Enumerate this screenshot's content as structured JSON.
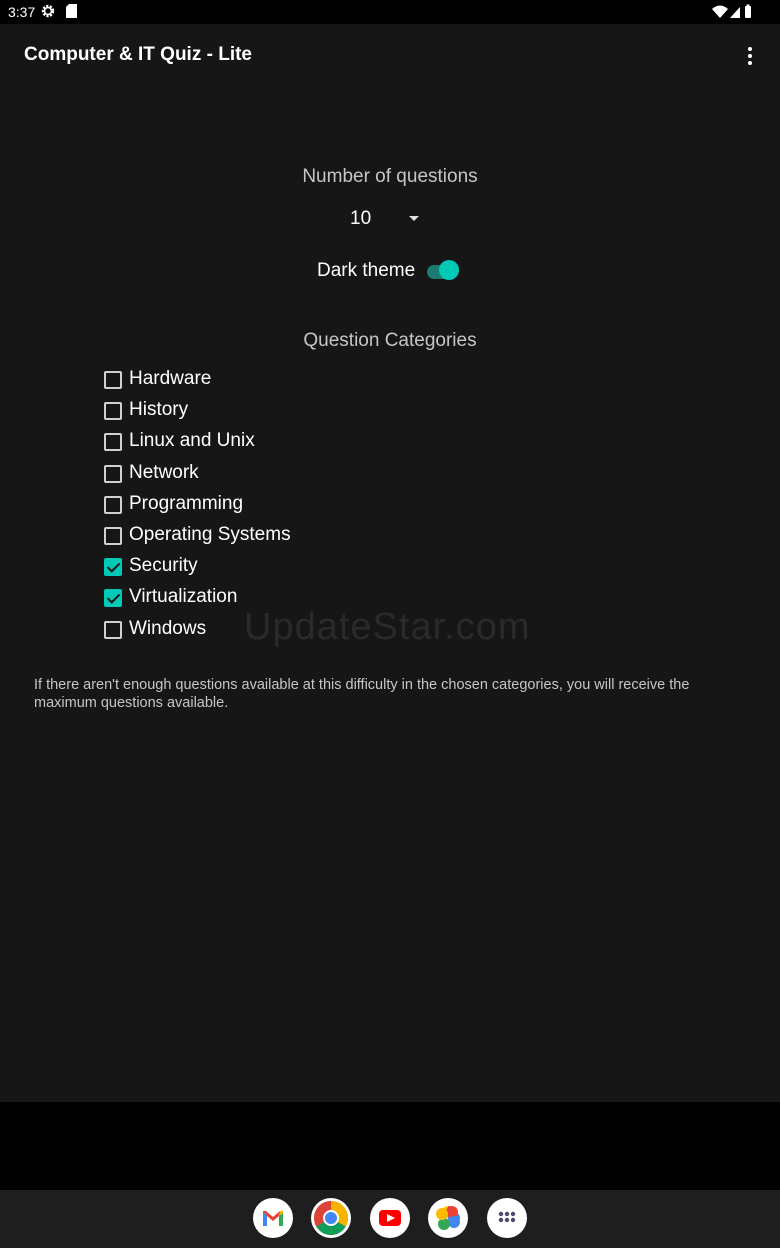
{
  "status_bar": {
    "time": "3:37"
  },
  "app_bar": {
    "title": "Computer & IT Quiz - Lite"
  },
  "settings": {
    "num_questions_label": "Number of questions",
    "num_questions_value": "10",
    "dark_theme_label": "Dark theme",
    "dark_theme_on": true,
    "categories_title": "Question Categories",
    "categories": [
      {
        "label": "Hardware",
        "checked": false
      },
      {
        "label": "History",
        "checked": false
      },
      {
        "label": "Linux and Unix",
        "checked": false
      },
      {
        "label": "Network",
        "checked": false
      },
      {
        "label": "Programming",
        "checked": false
      },
      {
        "label": "Operating Systems",
        "checked": false
      },
      {
        "label": "Security",
        "checked": true
      },
      {
        "label": "Virtualization",
        "checked": true
      },
      {
        "label": "Windows",
        "checked": false
      }
    ],
    "note": "If there aren't enough questions available at this difficulty in the chosen categories, you will receive the maximum questions available."
  },
  "watermark": "UpdateStar.com",
  "dock": {
    "apps": [
      "gmail-icon",
      "chrome-icon",
      "youtube-icon",
      "photos-icon",
      "app-drawer-icon"
    ]
  },
  "colors": {
    "accent": "#00c9b5",
    "background": "#161616"
  }
}
